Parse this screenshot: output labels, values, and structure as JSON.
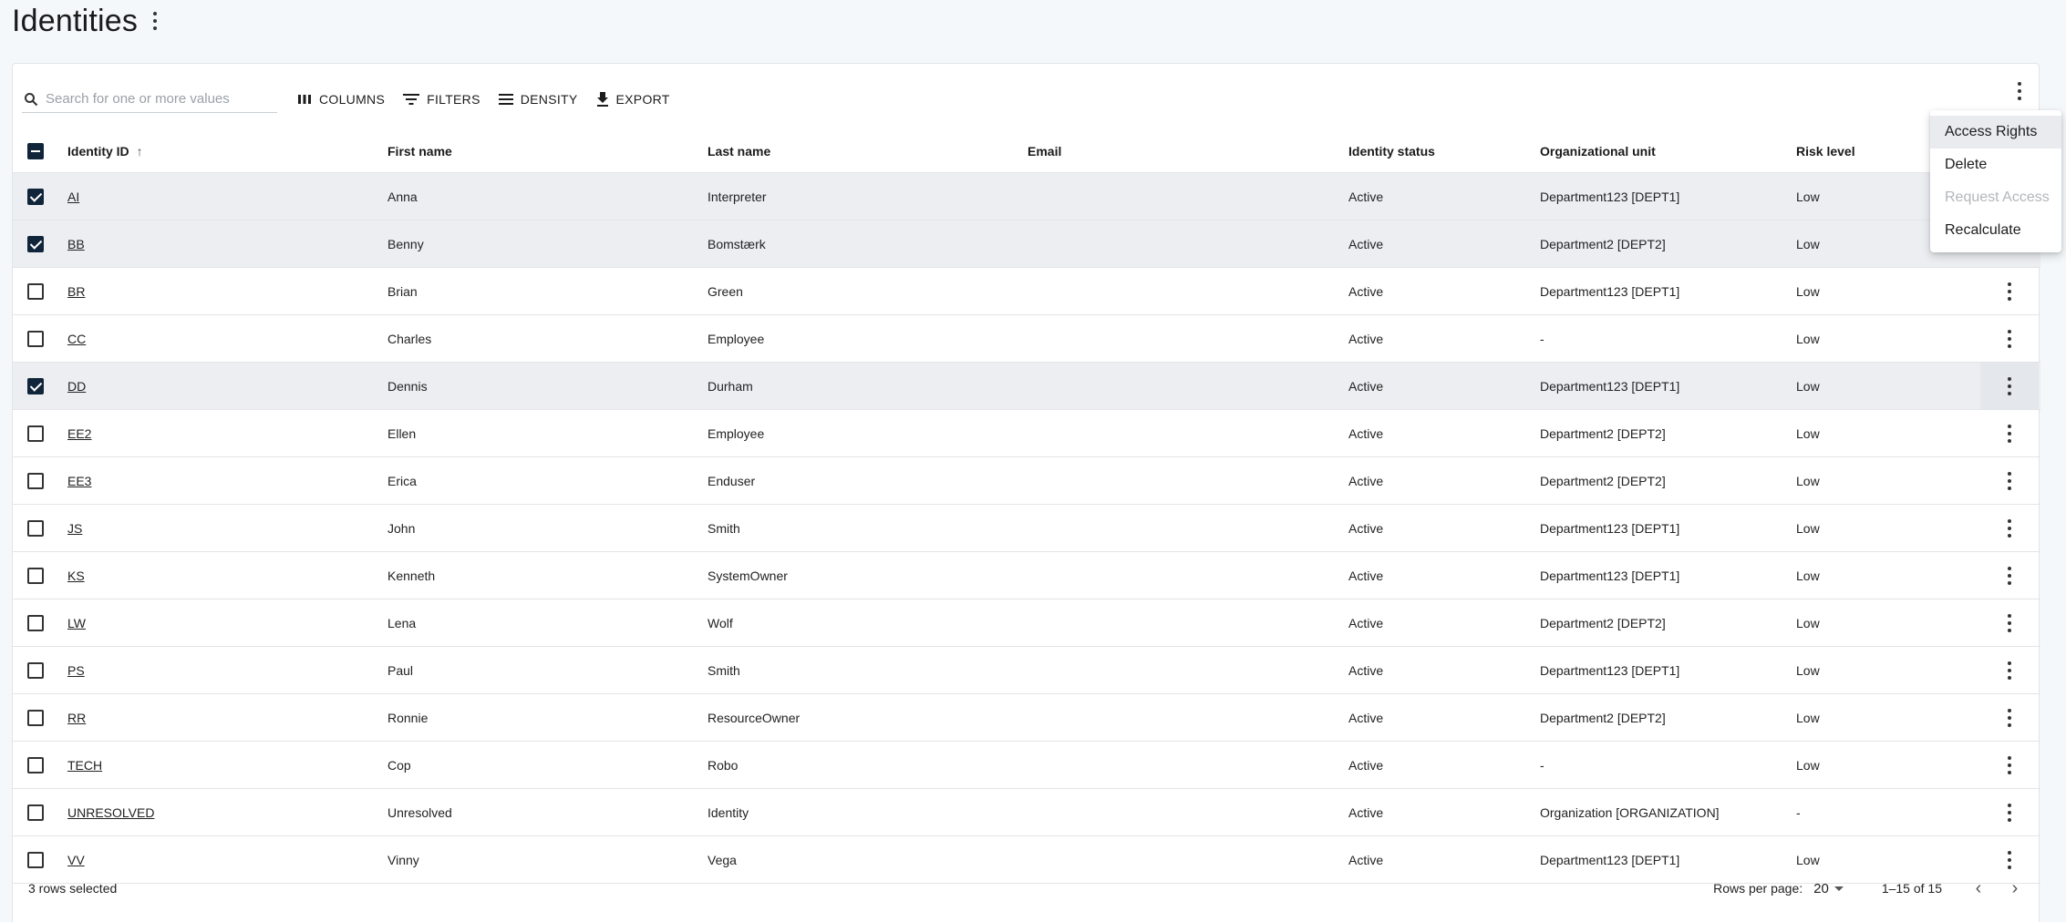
{
  "page": {
    "title": "Identities"
  },
  "toolbar": {
    "search_placeholder": "Search for one or more values",
    "columns_label": "COLUMNS",
    "filters_label": "FILTERS",
    "density_label": "DENSITY",
    "export_label": "EXPORT"
  },
  "table": {
    "columns": {
      "id": "Identity ID",
      "first": "First name",
      "last": "Last name",
      "email": "Email",
      "status": "Identity status",
      "org": "Organizational unit",
      "risk": "Risk level"
    },
    "sort": {
      "column": "Identity ID",
      "direction": "ascending"
    },
    "rows": [
      {
        "id": "AI",
        "first": "Anna",
        "last": "Interpreter",
        "email": "",
        "status": "Active",
        "org": "Department123 [DEPT1]",
        "risk": "Low",
        "selected": true
      },
      {
        "id": "BB",
        "first": "Benny",
        "last": "Bomstærk",
        "email": "",
        "status": "Active",
        "org": "Department2 [DEPT2]",
        "risk": "Low",
        "selected": true
      },
      {
        "id": "BR",
        "first": "Brian",
        "last": "Green",
        "email": "",
        "status": "Active",
        "org": "Department123 [DEPT1]",
        "risk": "Low",
        "selected": false
      },
      {
        "id": "CC",
        "first": "Charles",
        "last": "Employee",
        "email": "",
        "status": "Active",
        "org": "-",
        "risk": "Low",
        "selected": false
      },
      {
        "id": "DD",
        "first": "Dennis",
        "last": "Durham",
        "email": "",
        "status": "Active",
        "org": "Department123 [DEPT1]",
        "risk": "Low",
        "selected": true
      },
      {
        "id": "EE2",
        "first": "Ellen",
        "last": "Employee",
        "email": "",
        "status": "Active",
        "org": "Department2 [DEPT2]",
        "risk": "Low",
        "selected": false
      },
      {
        "id": "EE3",
        "first": "Erica",
        "last": "Enduser",
        "email": "",
        "status": "Active",
        "org": "Department2 [DEPT2]",
        "risk": "Low",
        "selected": false
      },
      {
        "id": "JS",
        "first": "John",
        "last": "Smith",
        "email": "",
        "status": "Active",
        "org": "Department123 [DEPT1]",
        "risk": "Low",
        "selected": false
      },
      {
        "id": "KS",
        "first": "Kenneth",
        "last": "SystemOwner",
        "email": "",
        "status": "Active",
        "org": "Department123 [DEPT1]",
        "risk": "Low",
        "selected": false
      },
      {
        "id": "LW",
        "first": "Lena",
        "last": "Wolf",
        "email": "",
        "status": "Active",
        "org": "Department2 [DEPT2]",
        "risk": "Low",
        "selected": false
      },
      {
        "id": "PS",
        "first": "Paul",
        "last": "Smith",
        "email": "",
        "status": "Active",
        "org": "Department123 [DEPT1]",
        "risk": "Low",
        "selected": false
      },
      {
        "id": "RR",
        "first": "Ronnie",
        "last": "ResourceOwner",
        "email": "",
        "status": "Active",
        "org": "Department2 [DEPT2]",
        "risk": "Low",
        "selected": false
      },
      {
        "id": "TECH",
        "first": "Cop",
        "last": "Robo",
        "email": "",
        "status": "Active",
        "org": "-",
        "risk": "Low",
        "selected": false
      },
      {
        "id": "UNRESOLVED",
        "first": "Unresolved",
        "last": "Identity",
        "email": "",
        "status": "Active",
        "org": "Organization [ORGANIZATION]",
        "risk": "-",
        "selected": false
      },
      {
        "id": "VV",
        "first": "Vinny",
        "last": "Vega",
        "email": "",
        "status": "Active",
        "org": "Department123 [DEPT1]",
        "risk": "Low",
        "selected": false
      }
    ]
  },
  "footer": {
    "selected_text": "3 rows selected",
    "rows_per_page_label": "Rows per page:",
    "rows_per_page_value": "20",
    "range_text": "1–15 of 15"
  },
  "menu": {
    "items": [
      {
        "label": "Access Rights",
        "state": "hover"
      },
      {
        "label": "Delete",
        "state": "enabled"
      },
      {
        "label": "Request Access",
        "state": "disabled"
      },
      {
        "label": "Recalculate",
        "state": "enabled"
      }
    ]
  },
  "icons": {
    "search": "search-icon",
    "columns": "columns-icon",
    "filters": "filter-icon",
    "density": "density-icon",
    "export": "download-icon",
    "more": "more-vert-icon",
    "sort": "arrow-up-icon",
    "prev": "chevron-left-icon",
    "next": "chevron-right-icon"
  },
  "colors": {
    "checkbox_checked": "#10253a",
    "row_selected": "#eceef1",
    "page_background": "#f4f8fb"
  }
}
